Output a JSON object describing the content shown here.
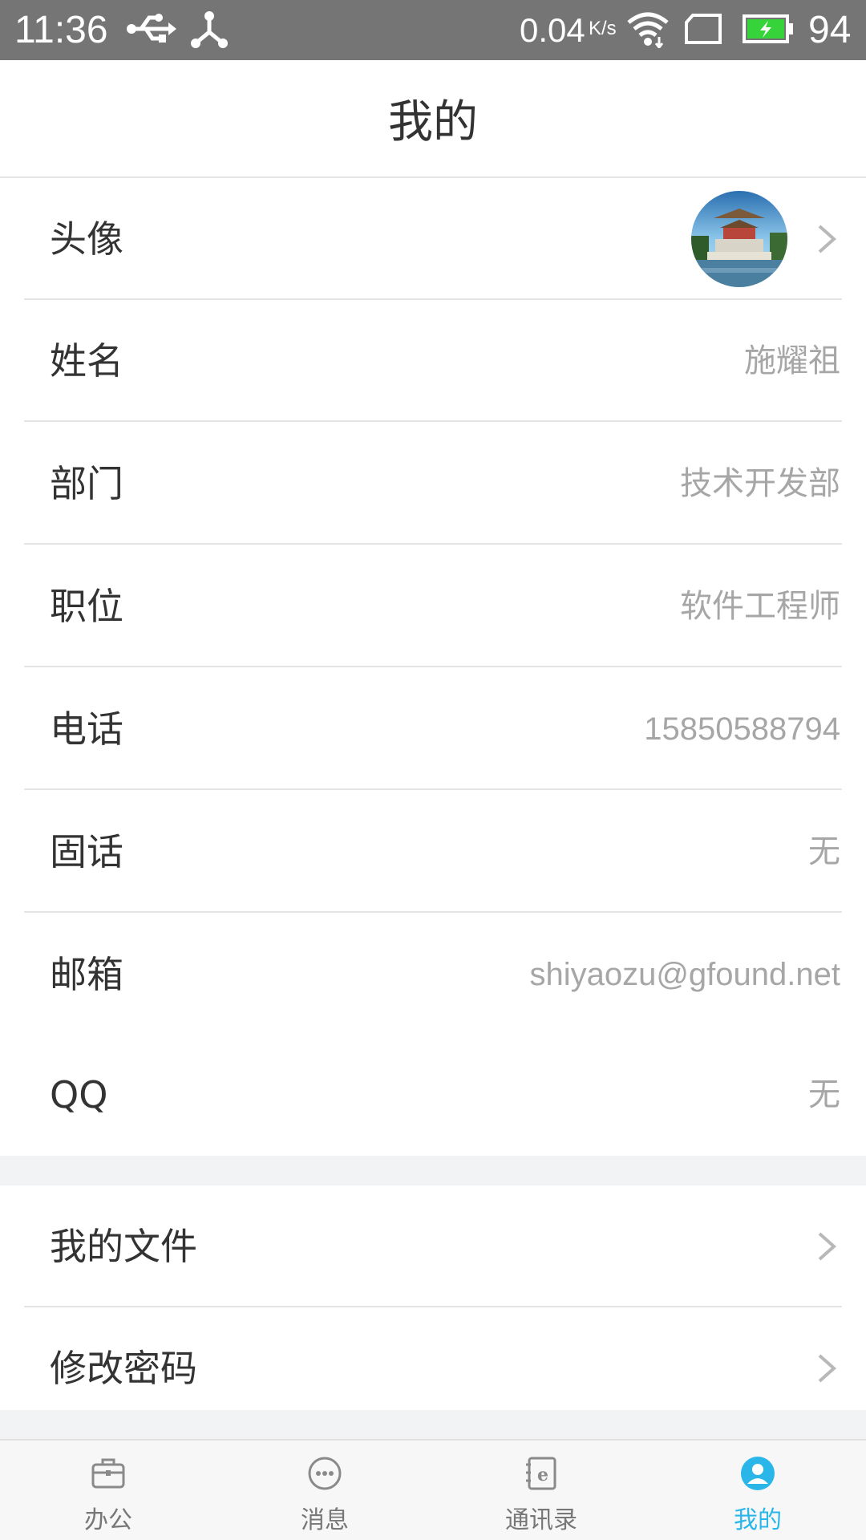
{
  "status_bar": {
    "time": "11:36",
    "network_speed": "0.04",
    "network_speed_unit": "K/s",
    "battery_level": "94",
    "icons": [
      "usb-icon",
      "share-icon",
      "wifi-icon",
      "sim-icon",
      "battery-icon"
    ],
    "battery_fill_color": "#36d43a"
  },
  "header": {
    "title": "我的"
  },
  "profile": {
    "avatar_label": "头像",
    "fields": [
      {
        "label": "姓名",
        "value": "施耀祖"
      },
      {
        "label": "部门",
        "value": "技术开发部"
      },
      {
        "label": "职位",
        "value": "软件工程师"
      },
      {
        "label": "电话",
        "value": "15850588794"
      },
      {
        "label": "固话",
        "value": "无"
      },
      {
        "label": "邮箱",
        "value": "shiyaozu@gfound.net"
      },
      {
        "label": "QQ",
        "value": "无"
      }
    ]
  },
  "menu": {
    "items": [
      {
        "label": "我的文件"
      },
      {
        "label": "修改密码"
      }
    ]
  },
  "bottom_nav": {
    "items": [
      {
        "label": "办公",
        "icon": "briefcase-icon"
      },
      {
        "label": "消息",
        "icon": "chat-bubble-icon"
      },
      {
        "label": "通讯录",
        "icon": "contacts-book-icon"
      },
      {
        "label": "我的",
        "icon": "user-icon",
        "active": true
      }
    ],
    "active_color": "#2ab6e8",
    "inactive_color": "#777777"
  }
}
